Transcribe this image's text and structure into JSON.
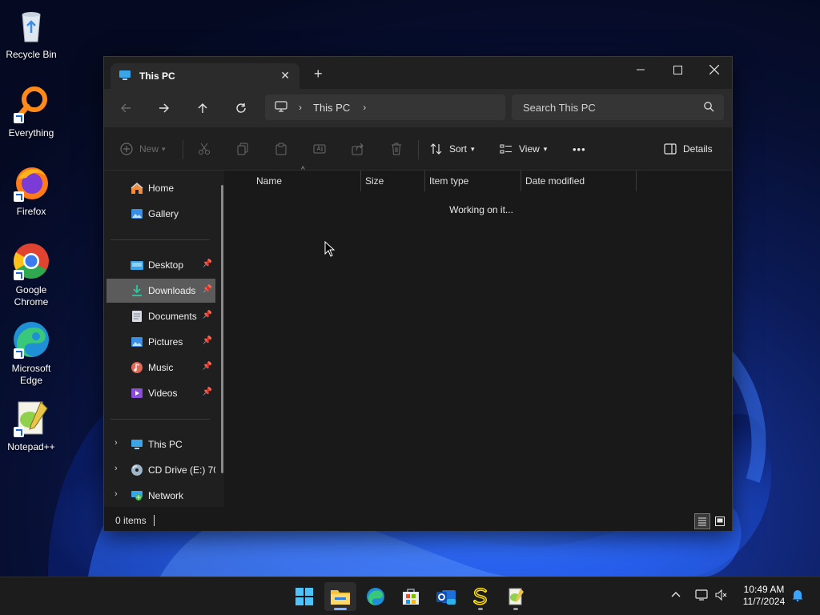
{
  "desktop": {
    "icons": [
      {
        "label": "Recycle Bin",
        "icon": "recycle-bin-icon"
      },
      {
        "label": "Everything",
        "icon": "everything-search-icon"
      },
      {
        "label": "Firefox",
        "icon": "firefox-icon"
      },
      {
        "label": "Google\nChrome",
        "icon": "chrome-icon"
      },
      {
        "label": "Microsoft\nEdge",
        "icon": "edge-icon"
      },
      {
        "label": "Notepad++",
        "icon": "notepad-plus-plus-icon"
      }
    ]
  },
  "window": {
    "tab_title": "This PC",
    "tab_close": "✕",
    "new_tab": "+",
    "address": {
      "crumbs": [
        "This PC"
      ]
    },
    "search": {
      "placeholder": "Search This PC"
    },
    "toolbar": {
      "new_label": "New",
      "sort_label": "Sort",
      "view_label": "View",
      "more_label": "•••",
      "details_label": "Details"
    },
    "sidebar": {
      "top": [
        {
          "label": "Home",
          "icon": "home-icon"
        },
        {
          "label": "Gallery",
          "icon": "gallery-icon"
        }
      ],
      "pinned": [
        {
          "label": "Desktop",
          "icon": "desktop-folder-icon"
        },
        {
          "label": "Downloads",
          "icon": "downloads-folder-icon",
          "selected": true
        },
        {
          "label": "Documents",
          "icon": "documents-folder-icon"
        },
        {
          "label": "Pictures",
          "icon": "pictures-folder-icon"
        },
        {
          "label": "Music",
          "icon": "music-folder-icon"
        },
        {
          "label": "Videos",
          "icon": "videos-folder-icon"
        }
      ],
      "drives": [
        {
          "label": "This PC",
          "icon": "this-pc-icon"
        },
        {
          "label": "CD Drive (E:) 70(",
          "icon": "cd-drive-icon"
        },
        {
          "label": "Network",
          "icon": "network-icon"
        }
      ]
    },
    "columns": [
      "Name",
      "Size",
      "Item type",
      "Date modified"
    ],
    "loading_text": "Working on it...",
    "status": {
      "items": "0 items"
    }
  },
  "taskbar": {
    "pinned": [
      "start-icon",
      "file-explorer-icon",
      "edge-icon",
      "store-icon",
      "outlook-new-icon",
      "sumatra-icon",
      "notepad-plus-plus-icon"
    ],
    "clock": {
      "time": "10:49 AM",
      "date": "11/7/2024"
    }
  },
  "colors": {
    "accent": "#7fb4ff",
    "selected_bg": "#5b5b5b",
    "window_bg": "#191919"
  }
}
